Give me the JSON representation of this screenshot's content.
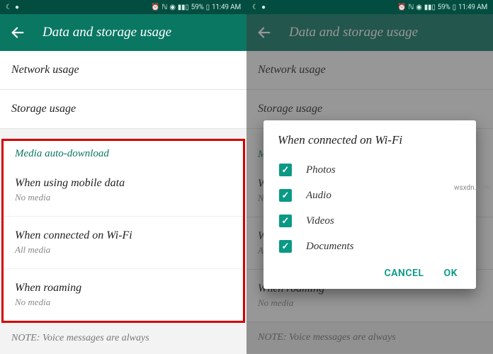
{
  "statusbar": {
    "battery": "59%",
    "time": "11:49 AM"
  },
  "appbar": {
    "title": "Data and storage usage"
  },
  "list": {
    "network": "Network usage",
    "storage": "Storage usage"
  },
  "section": {
    "header": "Media auto-download",
    "mobile": {
      "title": "When using mobile data",
      "sub": "No media"
    },
    "wifi": {
      "title": "When connected on Wi-Fi",
      "sub": "All media"
    },
    "roam": {
      "title": "When roaming",
      "sub": "No media"
    }
  },
  "note": "NOTE: Voice messages are always",
  "dialog": {
    "title": "When connected on Wi-Fi",
    "options": {
      "photos": "Photos",
      "audio": "Audio",
      "videos": "Videos",
      "documents": "Documents"
    },
    "cancel": "CANCEL",
    "ok": "OK"
  },
  "watermark": "wsxdn.com"
}
